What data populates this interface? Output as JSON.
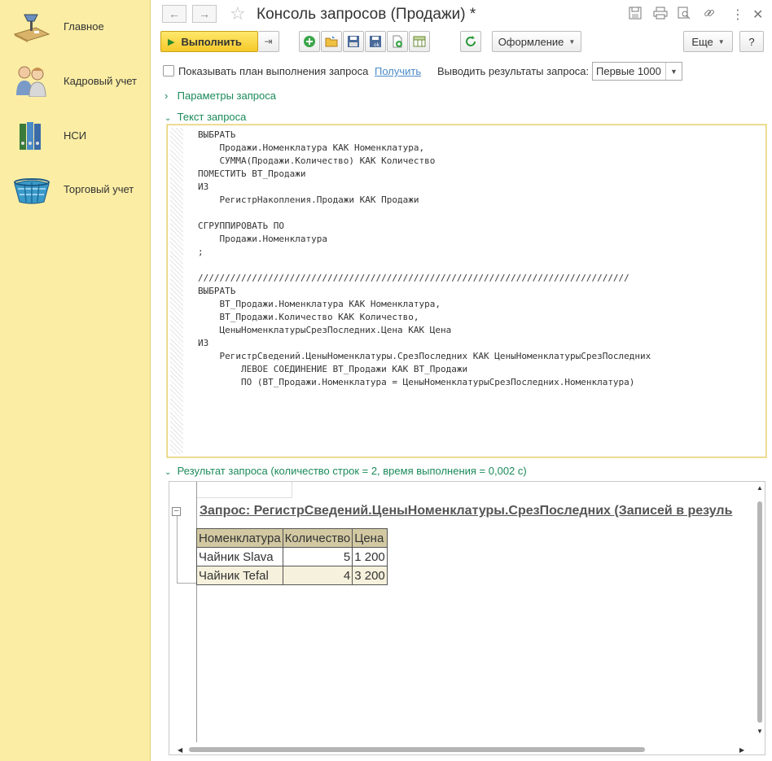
{
  "sidebar": {
    "items": [
      {
        "label": "Главное",
        "icon": "desk-lamp-icon"
      },
      {
        "label": "Кадровый учет",
        "icon": "people-icon"
      },
      {
        "label": "НСИ",
        "icon": "binders-icon"
      },
      {
        "label": "Торговый учет",
        "icon": "basket-icon"
      }
    ]
  },
  "window": {
    "title": "Консоль запросов (Продажи) *"
  },
  "toolbar": {
    "run_label": "Выполнить",
    "design_label": "Оформление",
    "more_label": "Еще",
    "help_label": "?"
  },
  "options": {
    "show_plan_label": "Показывать план выполнения запроса",
    "get_link": "Получить",
    "output_label": "Выводить результаты запроса:",
    "output_value": "Первые 1000"
  },
  "groups": {
    "params": "Параметры запроса",
    "query_text": "Текст запроса",
    "result": "Результат запроса (количество строк = 2, время выполнения = 0,002 с)"
  },
  "query_lines": [
    "ВЫБРАТЬ",
    "    Продажи.Номенклатура КАК Номенклатура,",
    "    СУММА(Продажи.Количество) КАК Количество",
    "ПОМЕСТИТЬ ВТ_Продажи",
    "ИЗ",
    "    РегистрНакопления.Продажи КАК Продажи",
    "",
    "СГРУППИРОВАТЬ ПО",
    "    Продажи.Номенклатура",
    ";",
    "",
    "////////////////////////////////////////////////////////////////////////////////",
    "ВЫБРАТЬ",
    "    ВТ_Продажи.Номенклатура КАК Номенклатура,",
    "    ВТ_Продажи.Количество КАК Количество,",
    "    ЦеныНоменклатурыСрезПоследних.Цена КАК Цена",
    "ИЗ",
    "    РегистрСведений.ЦеныНоменклатуры.СрезПоследних КАК ЦеныНоменклатурыСрезПоследних",
    "        ЛЕВОЕ СОЕДИНЕНИЕ ВТ_Продажи КАК ВТ_Продажи",
    "        ПО (ВТ_Продажи.Номенклатура = ЦеныНоменклатурыСрезПоследних.Номенклатура)"
  ],
  "result": {
    "header": "Запрос: РегистрСведений.ЦеныНоменклатуры.СрезПоследних (Записей в резуль",
    "columns": [
      "Номенклатура",
      "Количество",
      "Цена"
    ],
    "rows": [
      [
        "Чайник Slava",
        "5",
        "1 200"
      ],
      [
        "Чайник Tefal",
        "4",
        "3 200"
      ]
    ]
  }
}
